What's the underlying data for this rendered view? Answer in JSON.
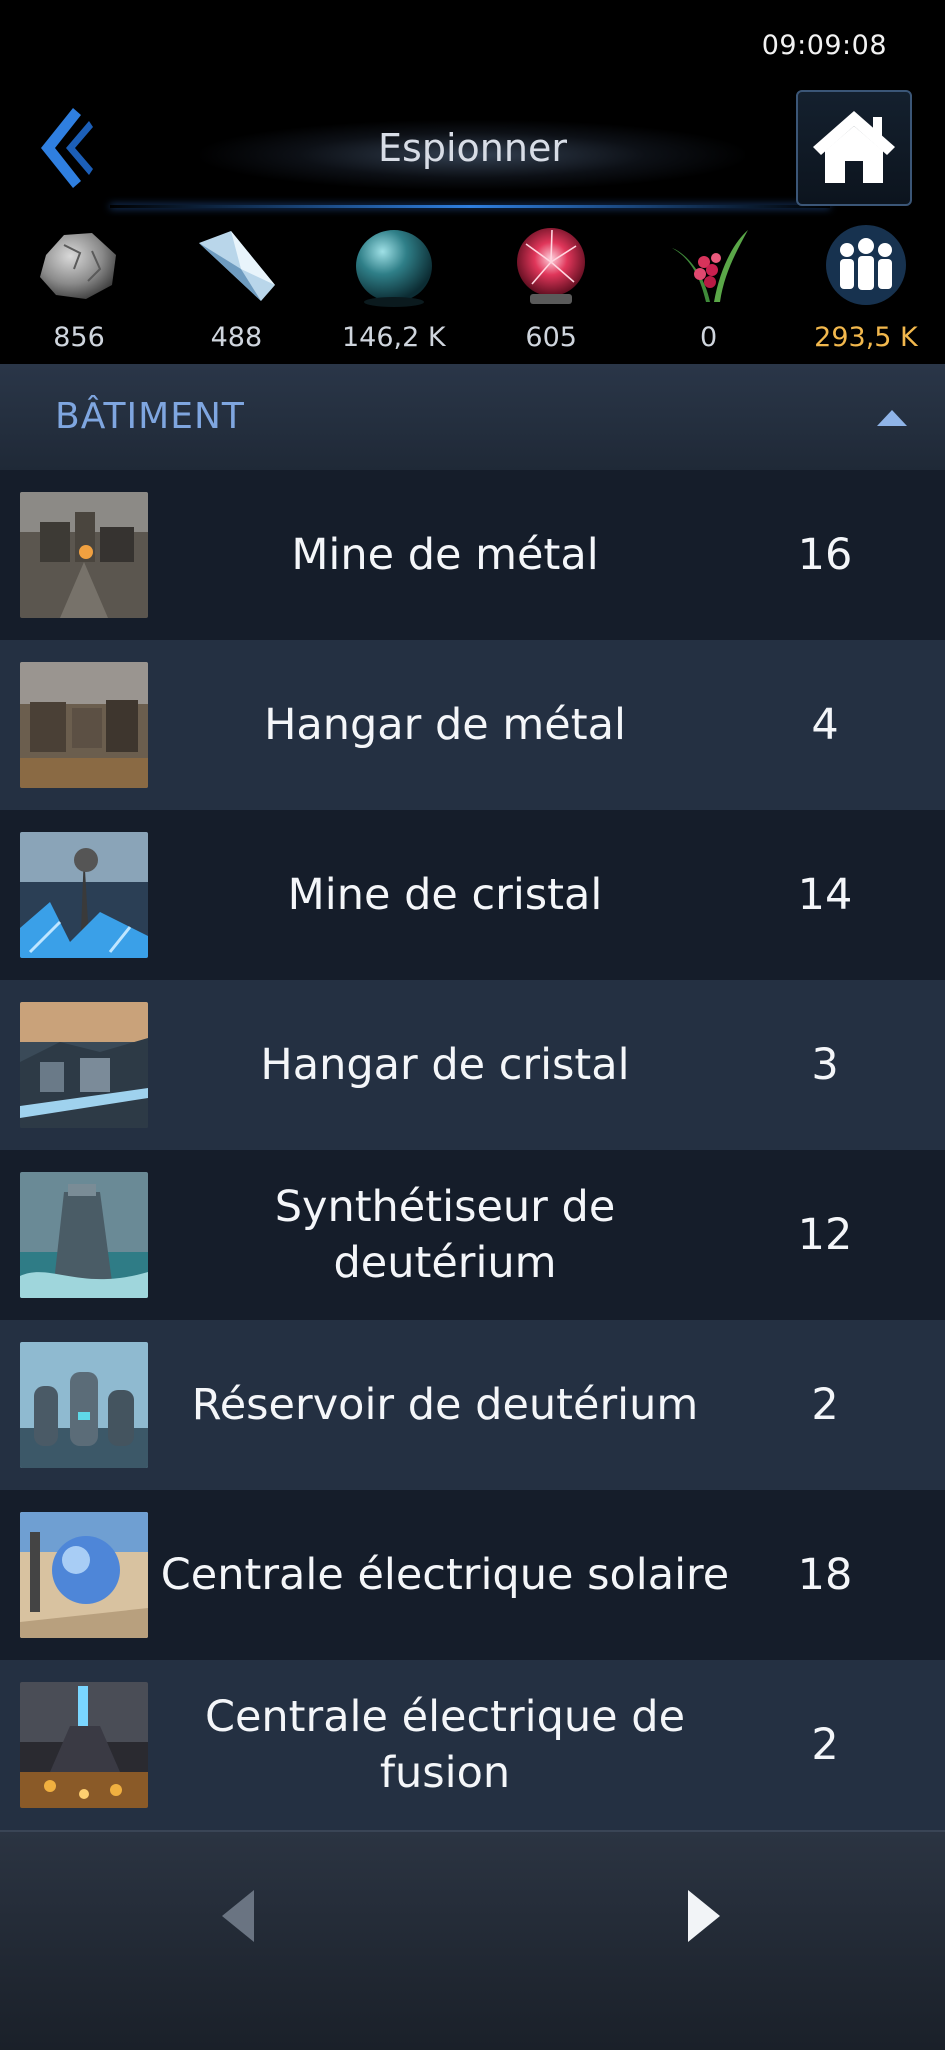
{
  "status_bar": {
    "time": "09:09:08"
  },
  "header": {
    "title": "Espionner"
  },
  "resources": [
    {
      "icon": "metal-ore-icon",
      "value": "856"
    },
    {
      "icon": "crystal-icon",
      "value": "488"
    },
    {
      "icon": "deuterium-orb-icon",
      "value": "146,2 K"
    },
    {
      "icon": "energy-plasma-icon",
      "value": "605"
    },
    {
      "icon": "plant-icon",
      "value": "0"
    },
    {
      "icon": "population-icon",
      "value": "293,5 K",
      "color": "#f2b84d"
    }
  ],
  "section": {
    "title": "BÂTIMENT"
  },
  "buildings": [
    {
      "name": "Mine de métal",
      "level": "16"
    },
    {
      "name": "Hangar de métal",
      "level": "4"
    },
    {
      "name": "Mine de cristal",
      "level": "14"
    },
    {
      "name": "Hangar de cristal",
      "level": "3"
    },
    {
      "name": "Synthétiseur de deutérium",
      "level": "12"
    },
    {
      "name": "Réservoir de deutérium",
      "level": "2"
    },
    {
      "name": "Centrale électrique solaire",
      "level": "18"
    },
    {
      "name": "Centrale électrique de fusion",
      "level": "2"
    }
  ],
  "colors": {
    "accent_blue": "#2f7fe0",
    "section_title": "#7fa6e0",
    "highlight": "#f2b84d"
  }
}
